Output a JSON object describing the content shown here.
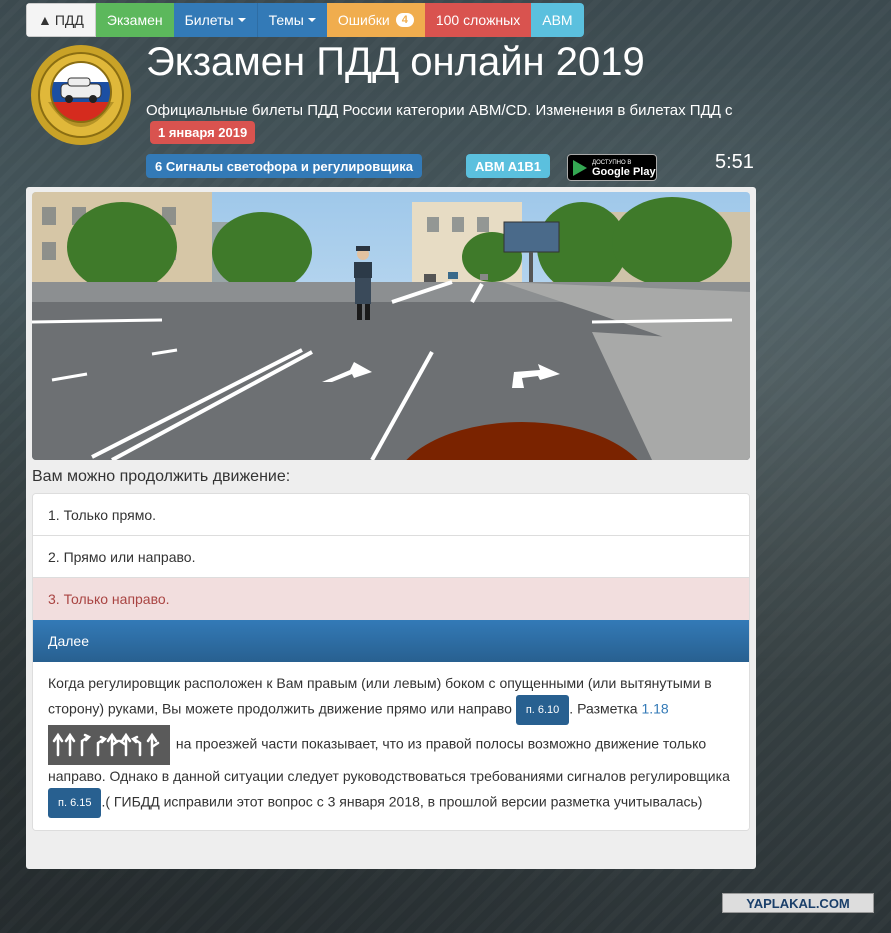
{
  "nav": {
    "home_label": "ПДД",
    "exam_label": "Экзамен",
    "tickets_label": "Билеты",
    "topics_label": "Темы",
    "errors_label": "Ошибки",
    "errors_count": "4",
    "hard_label": "100 сложных",
    "category_label": "ABM"
  },
  "header": {
    "title": "Экзамен ПДД онлайн 2019",
    "subtitle": "Официальные билеты ПДД России категории ABM/CD. Изменения в билетах ПДД с",
    "date_badge": "1 января 2019",
    "topic": "6 Сигналы светофора и регулировщика",
    "category": "ABM A1B1",
    "gplay_small": "ДОСТУПНО В",
    "gplay_big": "Google Play",
    "timer": "5:51"
  },
  "question": {
    "text": "Вам можно продолжить движение:",
    "answers": [
      "1. Только прямо.",
      "2. Прямо или направо.",
      "3. Только направо."
    ],
    "next_label": "Далее"
  },
  "explanation": {
    "part1": "Когда регулировщик расположен к Вам правым (или левым) боком с опущенными (или вытянутыми в сторону) руками, Вы можете продолжить движение прямо или направо",
    "ref1": "п. 6.10",
    "part2": ". Разметка",
    "marking_link": "1.18",
    "part3": "на проезжей части показывает, что из правой полосы возможно движение только направо. Однако в данной ситуации следует руководствоваться требованиями сигналов регулировщика",
    "ref2": "п. 6.15",
    "part4": ".( ГИБДД исправили этот вопрос с 3 января 2018, в прошлой версии разметка учитывалась)"
  },
  "watermark": "YAPLAKAL.COM",
  "colors": {
    "primary": "#337ab7",
    "success": "#5cb85c",
    "warning": "#f0ad4e",
    "danger": "#d9534f",
    "info": "#5bc0de",
    "wrong_answer_bg": "#f2dede"
  }
}
